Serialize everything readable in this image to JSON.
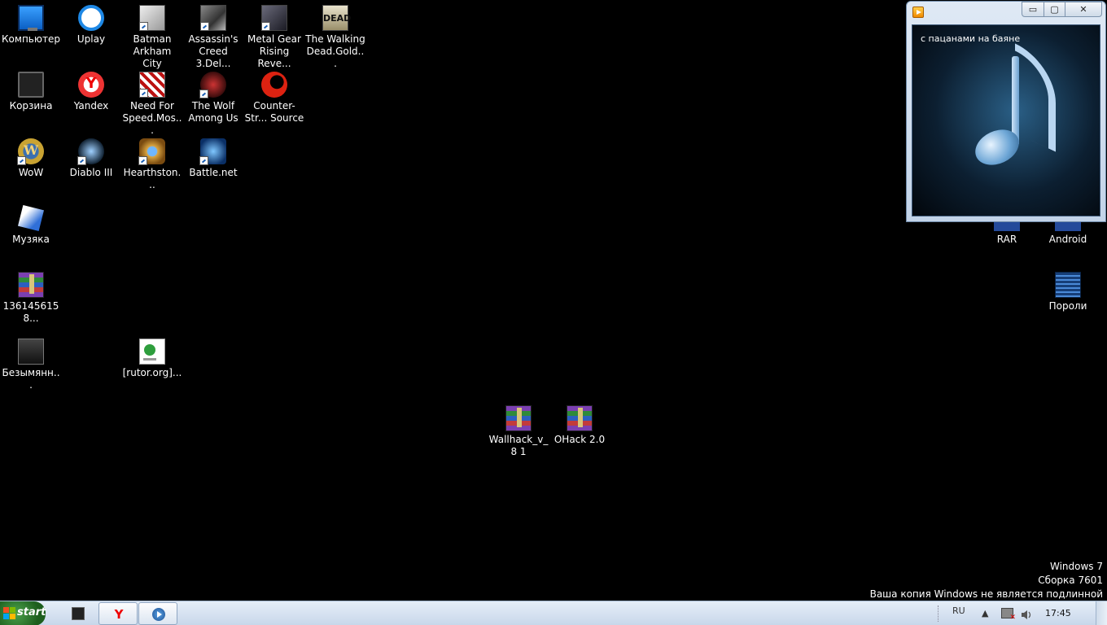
{
  "desktop": {
    "icons_left": [
      {
        "label": "Компьютер",
        "art": "computer"
      },
      {
        "label": "Uplay",
        "art": "uplay"
      },
      {
        "label": "Batman Arkham City",
        "art": "game-light"
      },
      {
        "label": "Assassin's Creed 3.Del...",
        "art": "game"
      },
      {
        "label": "Metal Gear Rising Reve...",
        "art": "game-dark"
      },
      {
        "label": "The Walking Dead.Gold...",
        "art": "game-dead"
      },
      {
        "label": "Корзина",
        "art": "recycle-bin"
      },
      {
        "label": "Yandex",
        "art": "yandex"
      },
      {
        "label": "Need For Speed.Mos...",
        "art": "nfs"
      },
      {
        "label": "The Wolf Among Us",
        "art": "wolf"
      },
      {
        "label": "Counter-Str... Source",
        "art": "cs"
      },
      {
        "label": "WoW",
        "art": "wow"
      },
      {
        "label": "Diablo III",
        "art": "diablo"
      },
      {
        "label": "Hearthston...",
        "art": "hearthstone"
      },
      {
        "label": "Battle.net",
        "art": "battlenet"
      },
      {
        "label": "Музяка",
        "art": "music"
      },
      {
        "label": "1361456158...",
        "art": "rar"
      },
      {
        "label": "Безымянн...",
        "art": "untitled"
      },
      {
        "label": "[rutor.org]...",
        "art": "torrent"
      }
    ],
    "icons_center": [
      {
        "label": "Wallhack_v_8 1",
        "art": "rar"
      },
      {
        "label": "OHack 2.0",
        "art": "rar"
      }
    ],
    "icons_right": [
      {
        "label": "RAR",
        "art": "partial"
      },
      {
        "label": "Android",
        "art": "partial"
      },
      {
        "label": "Пороли",
        "art": "passwords"
      }
    ],
    "walking_dead_art_text": "DEAD"
  },
  "media_window": {
    "track_title": "с пацанами на баяне",
    "min_symbol": "▭",
    "max_symbol": "▢",
    "close_symbol": "✕"
  },
  "watermark": {
    "line1": "Windows 7",
    "line2": "Сборка 7601",
    "line3": "Ваша копия Windows не является подлинной"
  },
  "taskbar": {
    "start_label": "start",
    "yandex_glyph": "Y",
    "tray": {
      "language": "RU",
      "expand_arrow": "▲",
      "time": "17:45"
    }
  },
  "colors": {
    "desktop_bg": "#000000",
    "taskbar_bg": "#d6e2f0",
    "start_green": "#2e7d2e"
  }
}
